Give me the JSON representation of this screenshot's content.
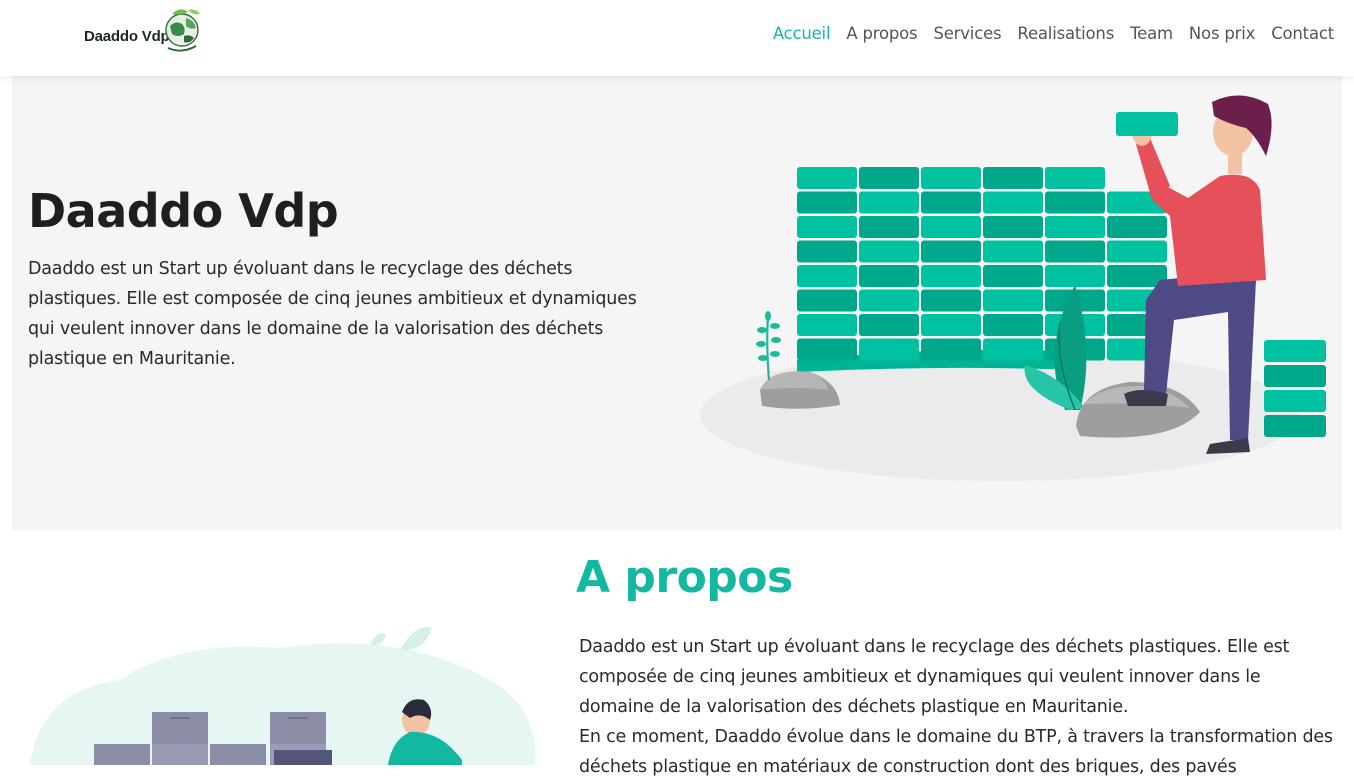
{
  "brand": {
    "name": "Daaddo Vdp"
  },
  "nav": {
    "items": [
      {
        "label": "Accueil",
        "active": true
      },
      {
        "label": "A propos",
        "active": false
      },
      {
        "label": "Services",
        "active": false
      },
      {
        "label": "Realisations",
        "active": false
      },
      {
        "label": "Team",
        "active": false
      },
      {
        "label": "Nos prix",
        "active": false
      },
      {
        "label": "Contact",
        "active": false
      }
    ]
  },
  "hero": {
    "title": "Daaddo Vdp",
    "text": "Daaddo est un Start up évoluant dans le recyclage des déchets plastiques. Elle est composée de cinq jeunes ambitieux et dynamiques qui veulent innover dans le domaine de la valorisation des déchets plastique en Mauritanie."
  },
  "about": {
    "title": "A propos",
    "paragraph1": "Daaddo est un Start up évoluant dans le recyclage des déchets plastiques. Elle est composée de cinq jeunes ambitieux et dynamiques qui veulent innover dans le domaine de la valorisation des déchets plastique en Mauritanie.",
    "paragraph2": "En ce moment, Daaddo évolue dans le domaine du BTP, à travers la transformation des déchets plastique en matériaux de construction dont des briques, des pavés"
  },
  "colors": {
    "accent": "#14b8a0",
    "brick_light": "#00c2a0",
    "brick_dark": "#00a88b",
    "shirt": "#e5505a",
    "pants": "#4e4a86",
    "hair": "#6b1f4a",
    "skin": "#f2c2a2",
    "hero_bg": "#f5f5f5"
  }
}
